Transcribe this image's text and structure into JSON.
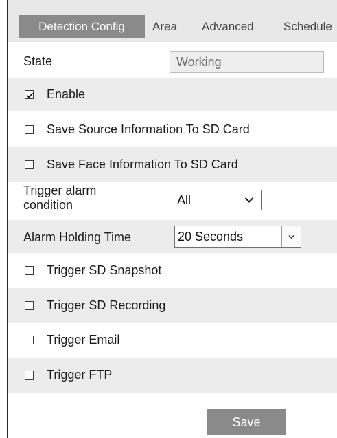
{
  "tabs": [
    {
      "label": "Detection Config",
      "active": true
    },
    {
      "label": "Area",
      "active": false
    },
    {
      "label": "Advanced",
      "active": false
    },
    {
      "label": "Schedule",
      "active": false
    }
  ],
  "state": {
    "label": "State",
    "value": "Working"
  },
  "checkboxes": [
    {
      "label": "Enable",
      "checked": true
    },
    {
      "label": "Save Source Information To SD Card",
      "checked": false
    },
    {
      "label": "Save Face Information To SD Card",
      "checked": false
    }
  ],
  "trigger_condition": {
    "label_line1": "Trigger alarm",
    "label_line2": "condition",
    "value": "All",
    "icon": "chevron-down-icon"
  },
  "alarm_holding": {
    "label": "Alarm Holding Time",
    "value": "20 Seconds",
    "icon": "dropdown-arrow-icon"
  },
  "triggers": [
    {
      "label": "Trigger SD Snapshot",
      "checked": false
    },
    {
      "label": "Trigger SD Recording",
      "checked": false
    },
    {
      "label": "Trigger Email",
      "checked": false
    },
    {
      "label": "Trigger FTP",
      "checked": false
    }
  ],
  "save_label": "Save",
  "colors": {
    "tab_active_bg": "#8a8a8a",
    "row_shade": "#ececec",
    "button_bg": "#8a8a8a"
  }
}
